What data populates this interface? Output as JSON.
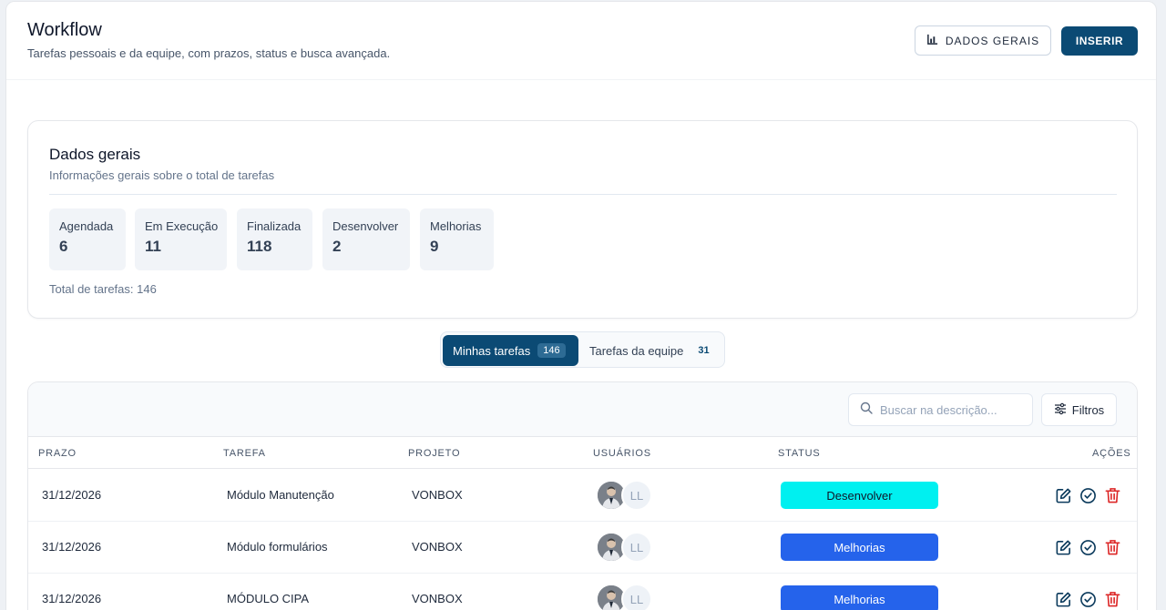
{
  "header": {
    "title": "Workflow",
    "subtitle": "Tarefas pessoais e da equipe, com prazos, status e busca avançada.",
    "btn_dados_gerais": "DADOS GERAIS",
    "btn_inserir": "INSERIR"
  },
  "summary": {
    "title": "Dados gerais",
    "subtitle": "Informações gerais sobre o total de tarefas",
    "stats": [
      {
        "label": "Agendada",
        "value": "6"
      },
      {
        "label": "Em Execução",
        "value": "11"
      },
      {
        "label": "Finalizada",
        "value": "118"
      },
      {
        "label": "Desenvolver",
        "value": "2"
      },
      {
        "label": "Melhorias",
        "value": "9"
      }
    ],
    "total": "Total de tarefas: 146"
  },
  "tabs": [
    {
      "label": "Minhas tarefas",
      "count": "146",
      "active": true
    },
    {
      "label": "Tarefas da equipe",
      "count": "31",
      "active": false
    }
  ],
  "table": {
    "search_placeholder": "Buscar na descrição...",
    "filters_label": "Filtros",
    "columns": [
      "PRAZO",
      "TAREFA",
      "PROJETO",
      "USUÁRIOS",
      "STATUS",
      "AÇÕES"
    ],
    "rows": [
      {
        "prazo": "31/12/2026",
        "tarefa": "Módulo Manutenção",
        "projeto": "VONBOX",
        "initials": "LL",
        "status": "Desenvolver",
        "status_color": "#00f0f0",
        "status_text_color": "#0f172a"
      },
      {
        "prazo": "31/12/2026",
        "tarefa": "Módulo formulários",
        "projeto": "VONBOX",
        "initials": "LL",
        "status": "Melhorias",
        "status_color": "#2563eb",
        "status_text_color": "#ffffff"
      },
      {
        "prazo": "31/12/2026",
        "tarefa": "MÓDULO CIPA",
        "projeto": "VONBOX",
        "initials": "LL",
        "status": "Melhorias",
        "status_color": "#2563eb",
        "status_text_color": "#ffffff"
      }
    ]
  },
  "icons": {
    "chart": "bar-chart-icon",
    "search": "search-icon",
    "filters": "sliders-icon",
    "edit": "edit-icon",
    "complete": "check-circle-icon",
    "delete": "trash-icon"
  },
  "colors": {
    "primary": "#0b4a74",
    "edit_icon": "#0b3a5c",
    "delete_icon": "#dc2626"
  }
}
